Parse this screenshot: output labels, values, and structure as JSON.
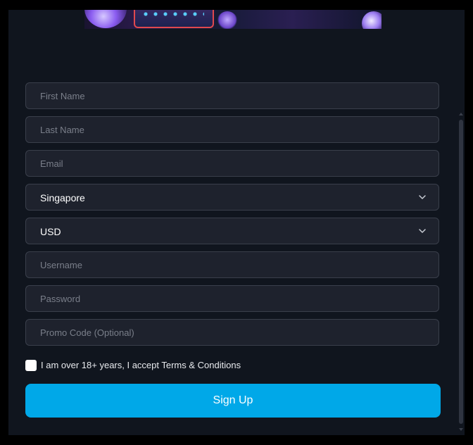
{
  "form": {
    "first_name": {
      "placeholder": "First Name",
      "value": ""
    },
    "last_name": {
      "placeholder": "Last Name",
      "value": ""
    },
    "email": {
      "placeholder": "Email",
      "value": ""
    },
    "country": {
      "selected": "Singapore"
    },
    "currency": {
      "selected": "USD"
    },
    "username": {
      "placeholder": "Username",
      "value": ""
    },
    "password": {
      "placeholder": "Password",
      "value": ""
    },
    "promo_code": {
      "placeholder": "Promo Code (Optional)",
      "value": ""
    },
    "terms_label": "I am over 18+ years, I accept Terms & Conditions",
    "terms_checked": false,
    "submit_label": "Sign Up"
  },
  "icons": {
    "select_arrow": "chevron-down-icon"
  },
  "colors": {
    "background": "#10151e",
    "field_bg": "#1e222d",
    "field_border": "#3a3f4b",
    "accent": "#00a8e8"
  }
}
